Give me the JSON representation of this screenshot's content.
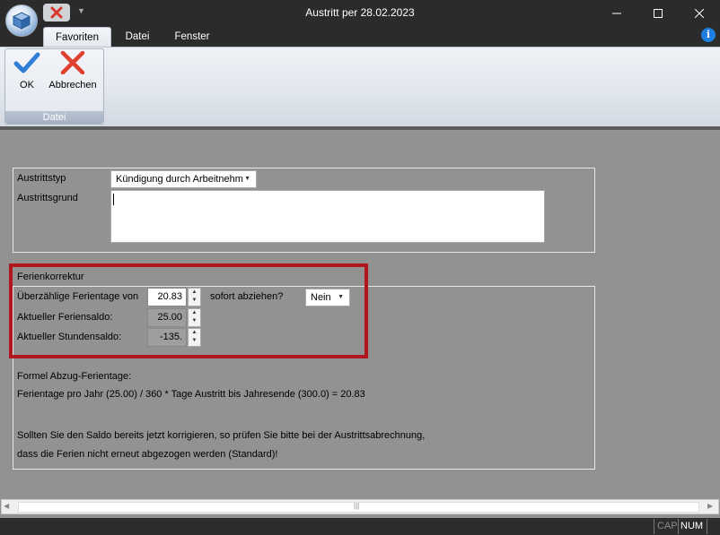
{
  "window": {
    "title": "Austritt per 28.02.2023",
    "minimize_glyph": "—",
    "maximize_glyph": "☐",
    "close_glyph": "✕"
  },
  "qat": {
    "dropdown_glyph": "▼"
  },
  "tabs": [
    {
      "label": "Favoriten",
      "selected": true
    },
    {
      "label": "Datei"
    },
    {
      "label": "Fenster"
    }
  ],
  "info_icon": "i",
  "ribbon": {
    "ok_label": "OK",
    "cancel_label": "Abbrechen",
    "group_label": "Datei"
  },
  "form": {
    "exit_type_label": "Austrittstyp",
    "exit_type_value": "Kündigung durch Arbeitnehm",
    "exit_reason_label": "Austrittsgrund",
    "exit_reason_value": "",
    "vacation_section_title": "Ferienkorrektur",
    "excess_days_label": "Überzählige Ferientage von",
    "excess_days_value": "20.83",
    "deduct_now_label": "sofort abziehen?",
    "deduct_now_value": "Nein",
    "vacation_balance_label": "Aktueller Feriensaldo:",
    "vacation_balance_value": "25.00",
    "hours_balance_label": "Aktueller Stundensaldo:",
    "hours_balance_value": "-135."
  },
  "formula": {
    "heading": "Formel Abzug-Ferientage:",
    "text": "Ferientage pro Jahr (25.00) / 360 * Tage Austritt bis Jahresende (300.0) = 20.83",
    "note_line1": "Sollten Sie den Saldo bereits jetzt korrigieren, so prüfen Sie bitte bei der Austrittsabrechnung,",
    "note_line2": "dass die Ferien nicht erneut abgezogen werden (Standard)!"
  },
  "scrollbar": {
    "left_arrow": "◀",
    "right_arrow": "▶",
    "grip": "|||"
  },
  "status": {
    "cap": "CAP",
    "num": "NUM"
  },
  "colors": {
    "highlight_border": "#b0161d",
    "ok_check": "#2f7fd6",
    "cancel_x": "#e0402f"
  }
}
